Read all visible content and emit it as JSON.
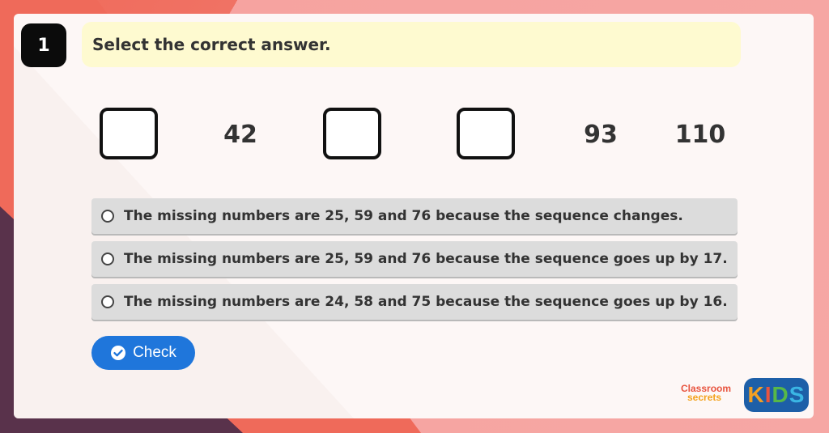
{
  "question": {
    "number": "1",
    "instruction": "Select the correct answer."
  },
  "sequence": {
    "items": [
      {
        "type": "box",
        "value": ""
      },
      {
        "type": "number",
        "value": "42"
      },
      {
        "type": "box",
        "value": ""
      },
      {
        "type": "box",
        "value": ""
      },
      {
        "type": "number",
        "value": "93"
      },
      {
        "type": "number",
        "value": "110"
      }
    ]
  },
  "options": [
    {
      "label": "The missing numbers are 25, 59 and 76 because the sequence changes."
    },
    {
      "label": "The missing numbers are 25, 59 and 76 because the sequence goes up by 17."
    },
    {
      "label": "The missing numbers are 24, 58 and 75 because the sequence goes up by 16."
    }
  ],
  "check_button": {
    "label": "Check",
    "icon": "check-circle-icon"
  },
  "branding": {
    "classroom_line1": "Classroom",
    "classroom_line2": "secrets",
    "kids_text": [
      "K",
      "I",
      "D",
      "S"
    ]
  },
  "colors": {
    "accent": "#1f76db",
    "instruction_bg": "#fefad0",
    "option_bg": "#dcdcdc"
  }
}
